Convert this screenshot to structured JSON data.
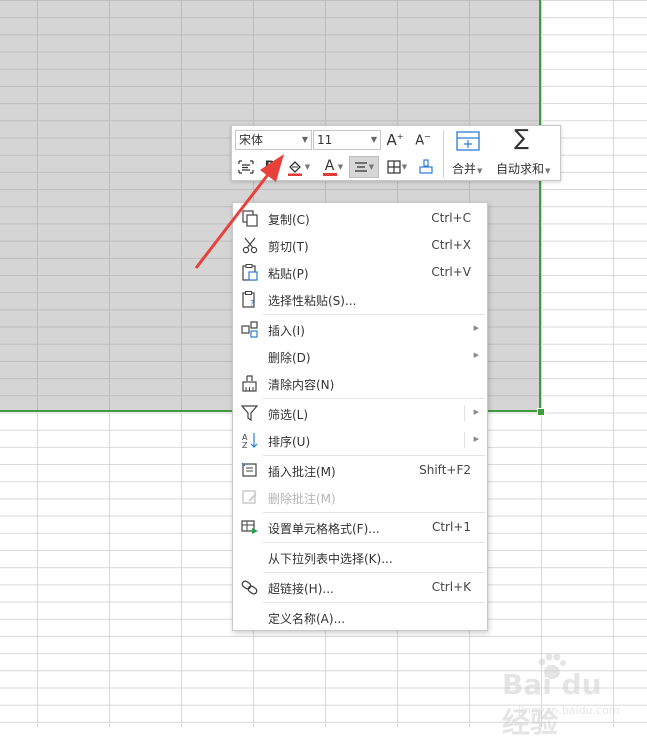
{
  "toolbar": {
    "font_name": "宋体",
    "font_size": "11",
    "merge_label": "合并",
    "autosum_label": "自动求和",
    "bold_label": "B",
    "font_color_label": "A",
    "grow_font_label": "A",
    "shrink_font_label": "A"
  },
  "menu": {
    "items": [
      {
        "label": "复制(C)",
        "shortcut": "Ctrl+C",
        "icon": "copy-icon"
      },
      {
        "label": "剪切(T)",
        "shortcut": "Ctrl+X",
        "icon": "cut-icon"
      },
      {
        "label": "粘贴(P)",
        "shortcut": "Ctrl+V",
        "icon": "paste-icon"
      },
      {
        "label": "选择性粘贴(S)...",
        "shortcut": "",
        "icon": "paste-special-icon"
      },
      {
        "label": "插入(I)",
        "shortcut": "",
        "icon": "insert-icon"
      },
      {
        "label": "删除(D)",
        "shortcut": "",
        "icon": ""
      },
      {
        "label": "清除内容(N)",
        "shortcut": "",
        "icon": "clear-content-icon"
      },
      {
        "label": "筛选(L)",
        "shortcut": "",
        "icon": "filter-icon"
      },
      {
        "label": "排序(U)",
        "shortcut": "",
        "icon": "sort-icon"
      },
      {
        "label": "插入批注(M)",
        "shortcut": "Shift+F2",
        "icon": "insert-comment-icon"
      },
      {
        "label": "删除批注(M)",
        "shortcut": "",
        "icon": "delete-comment-icon",
        "disabled": true
      },
      {
        "label": "设置单元格格式(F)...",
        "shortcut": "Ctrl+1",
        "icon": "format-cells-icon"
      },
      {
        "label": "从下拉列表中选择(K)...",
        "shortcut": "",
        "icon": ""
      },
      {
        "label": "超链接(H)...",
        "shortcut": "Ctrl+K",
        "icon": "hyperlink-icon"
      },
      {
        "label": "定义名称(A)...",
        "shortcut": "",
        "icon": ""
      }
    ]
  },
  "colors": {
    "selection_border": "#3f9b3f",
    "annotation_arrow": "#e8413b",
    "font_color_underline": "#e53935",
    "fill_color_underline": "#e53935"
  },
  "watermark": {
    "brand": "Bai du 经验",
    "site": "jingyan.baidu.com"
  }
}
